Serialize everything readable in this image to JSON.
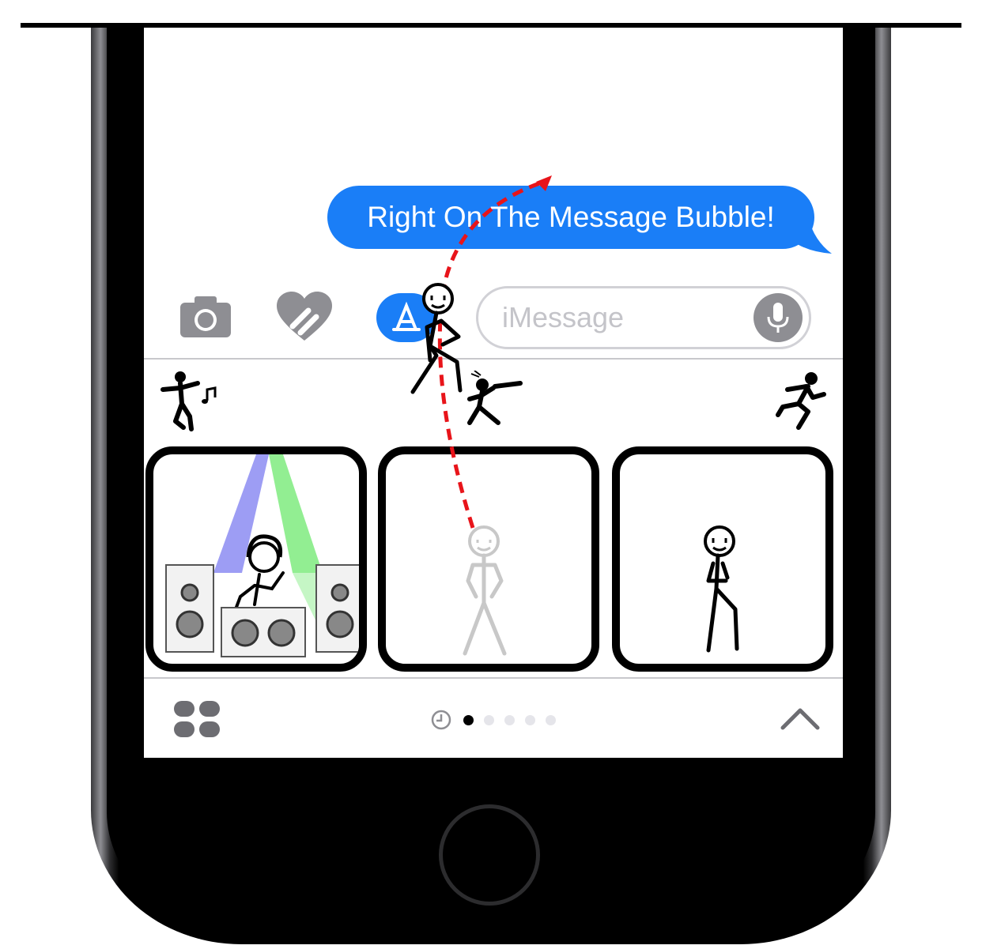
{
  "message": {
    "text": "Right On The Message Bubble!"
  },
  "compose": {
    "placeholder": "iMessage"
  },
  "toolbar": {
    "camera_icon": "camera-icon",
    "digital_touch_icon": "heart-touch-icon",
    "app_store_icon": "app-store-icon",
    "mic_icon": "microphone-icon"
  },
  "sticker_categories": [
    "dancing-stickman-icon",
    "sword-stickman-icon",
    "running-stickman-icon"
  ],
  "stickers": [
    "dj-stickman-sticker",
    "standing-stickman-sticker-faded",
    "walking-stickman-sticker"
  ],
  "drawer": {
    "apps_icon": "app-drawer-icon",
    "recents_icon": "clock-icon",
    "page_count": 5,
    "active_page": 0,
    "collapse_icon": "chevron-up-icon"
  },
  "colors": {
    "bubble_blue": "#1a7ef7",
    "toolbar_gray": "#8e8e93",
    "annotation_red": "#e8141a"
  }
}
